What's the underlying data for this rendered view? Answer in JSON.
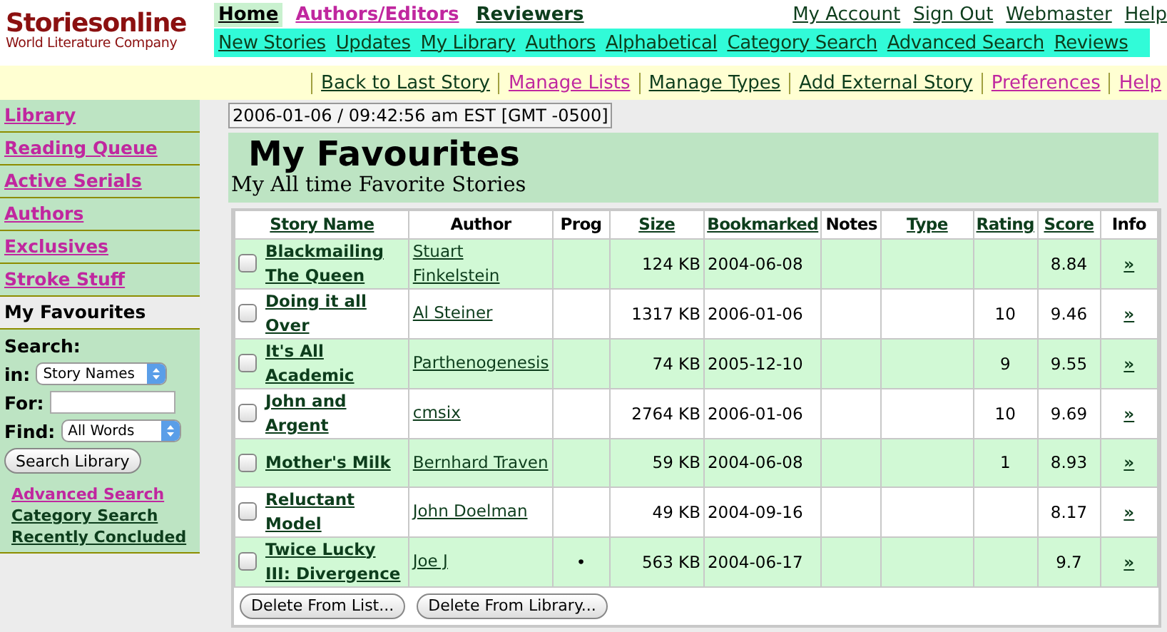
{
  "logo": {
    "name": "Storiesonline",
    "tagline": "World Literature Company"
  },
  "main_nav": [
    {
      "label": "Home",
      "selected": true,
      "visited": false
    },
    {
      "label": "Authors/Editors",
      "selected": false,
      "visited": true
    },
    {
      "label": "Reviewers",
      "selected": false,
      "visited": false
    }
  ],
  "account_nav": [
    {
      "label": "My Account"
    },
    {
      "label": "Sign Out"
    },
    {
      "label": "Webmaster"
    },
    {
      "label": "Help"
    }
  ],
  "sub_nav": [
    {
      "label": "New Stories"
    },
    {
      "label": "Updates"
    },
    {
      "label": "My Library"
    },
    {
      "label": "Authors"
    },
    {
      "label": "Alphabetical"
    },
    {
      "label": "Category Search"
    },
    {
      "label": "Advanced Search"
    },
    {
      "label": "Reviews"
    }
  ],
  "toolbar_links": [
    {
      "label": "Back to Last Story",
      "visited": false
    },
    {
      "label": "Manage Lists",
      "visited": true
    },
    {
      "label": "Manage Types",
      "visited": false
    },
    {
      "label": "Add External Story",
      "visited": false
    },
    {
      "label": "Preferences",
      "visited": true
    },
    {
      "label": "Help",
      "visited": true
    }
  ],
  "sidebar": {
    "items": [
      {
        "label": "Library",
        "selected": false
      },
      {
        "label": "Reading Queue",
        "selected": false
      },
      {
        "label": "Active Serials",
        "selected": false
      },
      {
        "label": "Authors",
        "selected": false
      },
      {
        "label": "Exclusives",
        "selected": false
      },
      {
        "label": "Stroke Stuff",
        "selected": false
      },
      {
        "label": "My Favourites",
        "selected": true
      }
    ],
    "search": {
      "title": "Search:",
      "in_label": "in:",
      "in_value": "Story Names",
      "for_label": "For:",
      "find_label": "Find:",
      "find_value": "All Words",
      "button": "Search Library"
    },
    "links": [
      {
        "label": "Advanced Search",
        "visited": true
      },
      {
        "label": "Category Search",
        "visited": false
      },
      {
        "label": "Recently Concluded",
        "visited": false
      }
    ]
  },
  "timestamp": "2006-01-06 / 09:42:56 am EST [GMT -0500]",
  "page": {
    "title": "My Favourites",
    "subtitle": "My All time Favorite Stories"
  },
  "table": {
    "columns": [
      {
        "label": "Story Name",
        "sortable": true
      },
      {
        "label": "Author",
        "sortable": false
      },
      {
        "label": "Prog",
        "sortable": false
      },
      {
        "label": "Size",
        "sortable": true
      },
      {
        "label": "Bookmarked",
        "sortable": true
      },
      {
        "label": "Notes",
        "sortable": false
      },
      {
        "label": "Type",
        "sortable": true
      },
      {
        "label": "Rating",
        "sortable": true
      },
      {
        "label": "Score",
        "sortable": true
      },
      {
        "label": "Info",
        "sortable": false
      }
    ],
    "rows": [
      {
        "checked": false,
        "story": "Blackmailing The Queen",
        "author": "Stuart Finkelstein",
        "size": "124 KB",
        "bookmarked": "2004-06-08",
        "score": "8.84",
        "info": "»"
      },
      {
        "checked": false,
        "story": "Doing it all Over",
        "author": "Al Steiner",
        "size": "1317 KB",
        "bookmarked": "2006-01-06",
        "rating": "10",
        "score": "9.46",
        "info": "»"
      },
      {
        "checked": false,
        "story": "It's All Academic",
        "author": "Parthenogenesis",
        "size": "74 KB",
        "bookmarked": "2005-12-10",
        "rating": "9",
        "score": "9.55",
        "info": "»"
      },
      {
        "checked": false,
        "story": "John and Argent",
        "author": "cmsix",
        "size": "2764 KB",
        "bookmarked": "2006-01-06",
        "rating": "10",
        "score": "9.69",
        "info": "»"
      },
      {
        "checked": false,
        "story": "Mother's Milk",
        "author": "Bernhard Traven",
        "size": "59 KB",
        "bookmarked": "2004-06-08",
        "rating": "1",
        "score": "8.93",
        "info": "»"
      },
      {
        "checked": false,
        "story": "Reluctant Model",
        "author": "John Doelman",
        "size": "49 KB",
        "bookmarked": "2004-09-16",
        "score": "8.17",
        "info": "»"
      },
      {
        "checked": false,
        "story": "Twice Lucky III: Divergence",
        "author": "Joe J",
        "prog": "•",
        "size": "563 KB",
        "bookmarked": "2004-06-17",
        "score": "9.7",
        "info": "»"
      }
    ]
  },
  "buttons": [
    {
      "label": "Delete From List..."
    },
    {
      "label": "Delete From Library..."
    }
  ]
}
